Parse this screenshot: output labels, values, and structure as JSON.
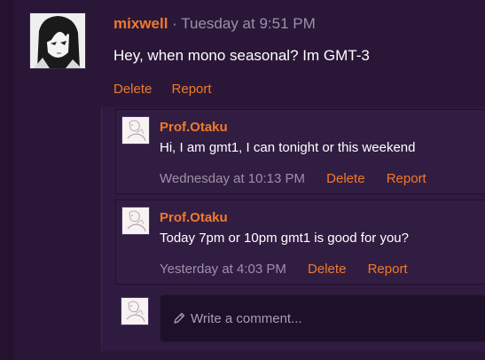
{
  "post": {
    "username": "mixwell",
    "separator": "·",
    "timestamp": "Tuesday at 9:51 PM",
    "message": "Hey, when mono seasonal? Im GMT-3",
    "actions": {
      "delete": "Delete",
      "report": "Report"
    }
  },
  "comments": [
    {
      "username": "Prof.Otaku",
      "text": "Hi, I am gmt1, I can tonight or this weekend",
      "timestamp": "Wednesday at 10:13 PM",
      "delete": "Delete",
      "report": "Report"
    },
    {
      "username": "Prof.Otaku",
      "text": "Today 7pm or 10pm gmt1 is good for you?",
      "timestamp": "Yesterday at 4:03 PM",
      "delete": "Delete",
      "report": "Report"
    }
  ],
  "reply": {
    "placeholder": "Write a comment..."
  },
  "colors": {
    "background": "#2a1738",
    "accent": "#f07a2a",
    "muted_text": "#9d8fa9",
    "text": "#ffffff",
    "input_bg": "#1f1029"
  },
  "icons": {
    "main_avatar": "manga-girl-avatar",
    "comment_avatar": "sketch-avatar",
    "input_icon": "pencil-icon"
  }
}
